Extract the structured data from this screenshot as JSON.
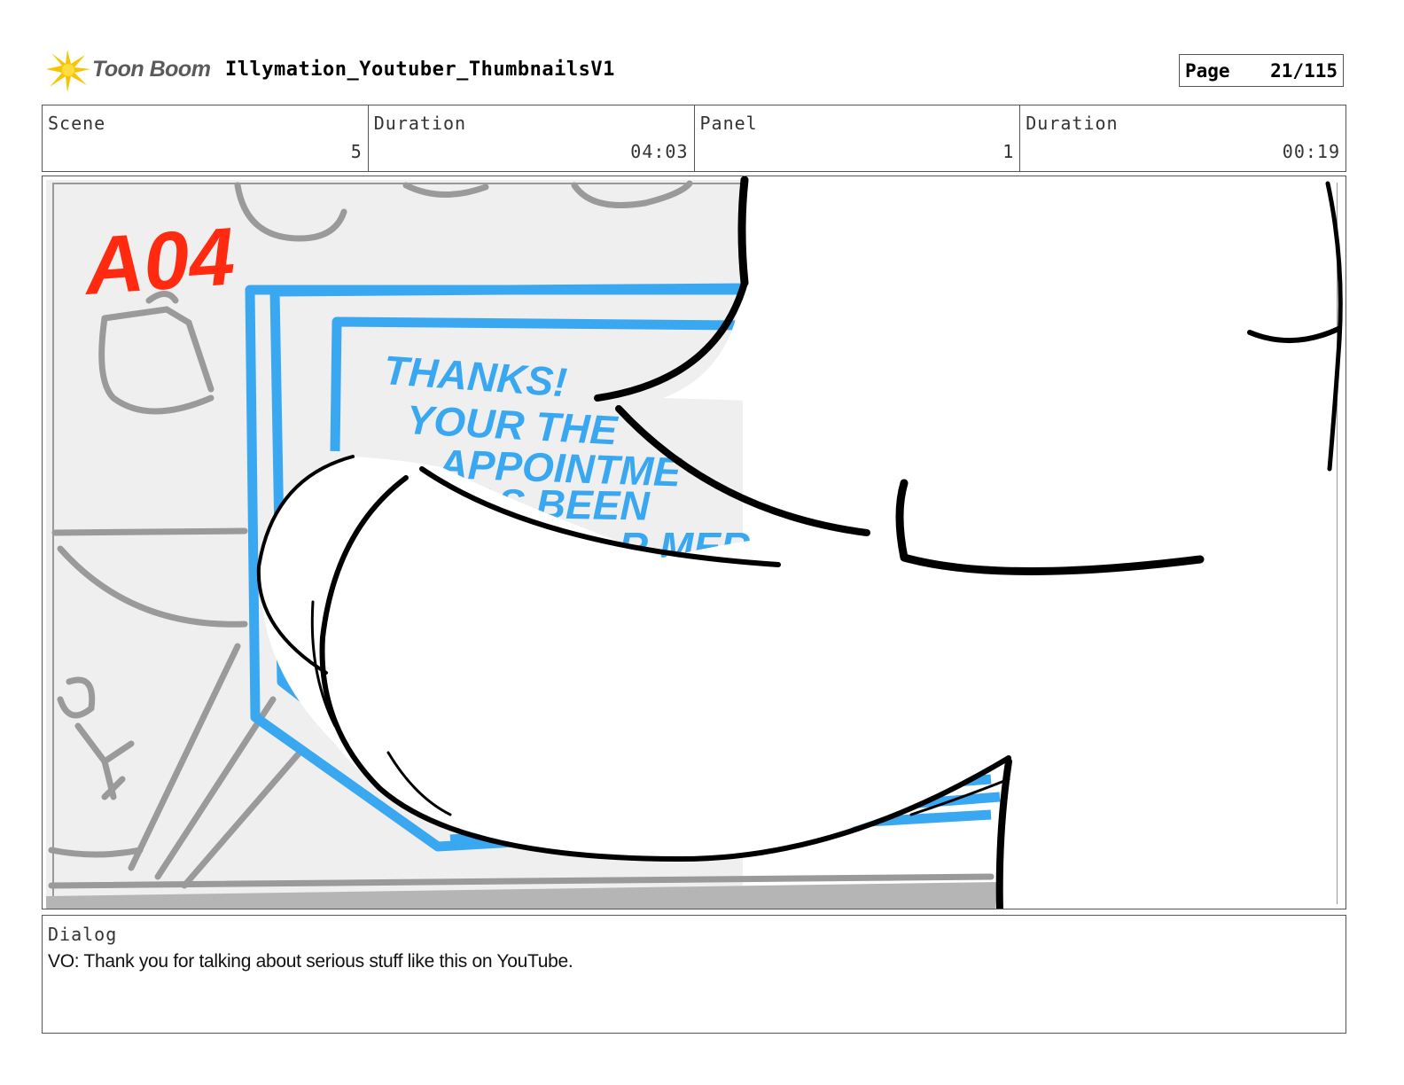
{
  "header": {
    "logo_text": "Toon Boom",
    "project_title": "Illymation_Youtuber_ThumbnailsV1",
    "page_label": "Page",
    "page_number": "21/115"
  },
  "info": {
    "scene_label": "Scene",
    "scene_value": "5",
    "scene_duration_label": "Duration",
    "scene_duration_value": "04:03",
    "panel_label": "Panel",
    "panel_value": "1",
    "panel_duration_label": "Duration",
    "panel_duration_value": "00:19"
  },
  "panel": {
    "sketch_tag": "A04",
    "screen_text_lines": [
      "THANKS!",
      "YOUR THE",
      "APPOINTME",
      "AS BEEN",
      "R MER"
    ]
  },
  "dialog": {
    "label": "Dialog",
    "text": "VO: Thank you for talking about serious stuff like this on YouTube."
  },
  "colors": {
    "sketch_red": "#ff2a10",
    "sketch_blue": "#3aa8f0",
    "sketch_gray": "#9a9a9a",
    "logo_yellow": "#f7c400"
  }
}
